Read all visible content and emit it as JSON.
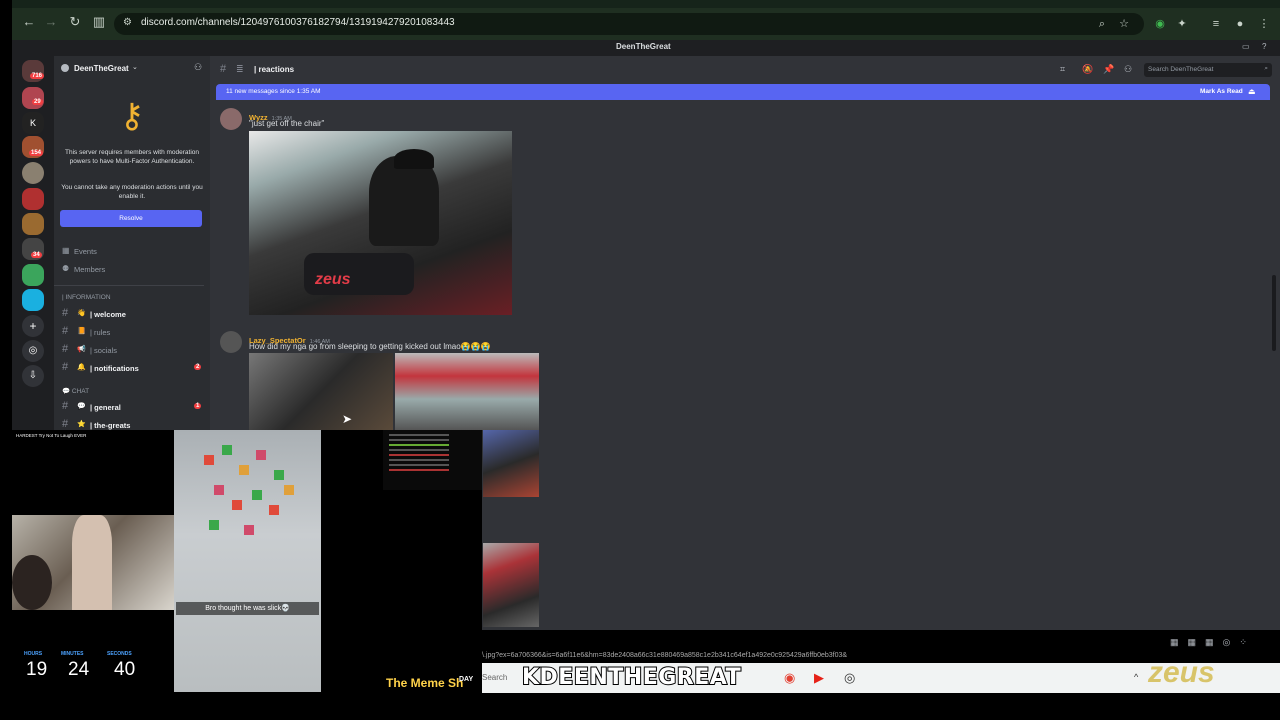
{
  "browser": {
    "url": "discord.com/channels/1204976100376182794/1319194279201083443"
  },
  "app_title": "DeenTheGreat",
  "server": {
    "name": "DeenTheGreat",
    "mfa_notice": "This server requires members with moderation powers to have Multi-Factor Authentication.",
    "mfa_sub": "You cannot take any moderation actions until you enable it.",
    "resolve_label": "Resolve",
    "rail_badges": [
      "716",
      "29",
      "154",
      "34"
    ]
  },
  "sidebar": {
    "events": "Events",
    "members": "Members",
    "category_info": "| INFORMATION",
    "category_chat": "CHAT",
    "channels": [
      {
        "name": "| welcome",
        "unread": true
      },
      {
        "name": "| rules",
        "unread": false
      },
      {
        "name": "| socials",
        "unread": false
      },
      {
        "name": "| notifications",
        "unread": true,
        "badge": "2"
      },
      {
        "name": "| general",
        "unread": true,
        "badge": "1"
      },
      {
        "name": "| the-greats",
        "unread": true
      }
    ]
  },
  "channel": {
    "name": "| reactions",
    "search_placeholder": "Search DeenTheGreat"
  },
  "banner": {
    "text": "11 new messages since 1:35 AM",
    "action": "Mark As Read"
  },
  "messages": [
    {
      "author": "Wyzz",
      "time": "1:35 AM",
      "text": "\"just get off the chair\"",
      "image_text": "zeus"
    },
    {
      "author": "Lazy_SpectatOr",
      "time": "1:46 AM",
      "text": "How did my nga go from sleeping to getting kicked out lmao😭😭😭"
    }
  ],
  "overlay": {
    "stream_title": "HARDEST Try Not To Laugh EVER",
    "caption": "Bro thought he was slick💀",
    "timer_labels": [
      "HOURS",
      "MINUTES",
      "SECONDS"
    ],
    "timer_values": [
      "19",
      "24",
      "40"
    ],
    "meme_shop": "The Meme Sh",
    "day_label": "DAY",
    "status_url": "\\.jpg?ex=6a706366&is=6a6f11e6&hm=83de2408a66c31e880469a858c1e2b341c64ef1a492e0c925429a6ffb0eb3f03&",
    "watermark": "KDEENTHEGREAT",
    "taskbar_search": "Search",
    "zeus": "zeus"
  }
}
